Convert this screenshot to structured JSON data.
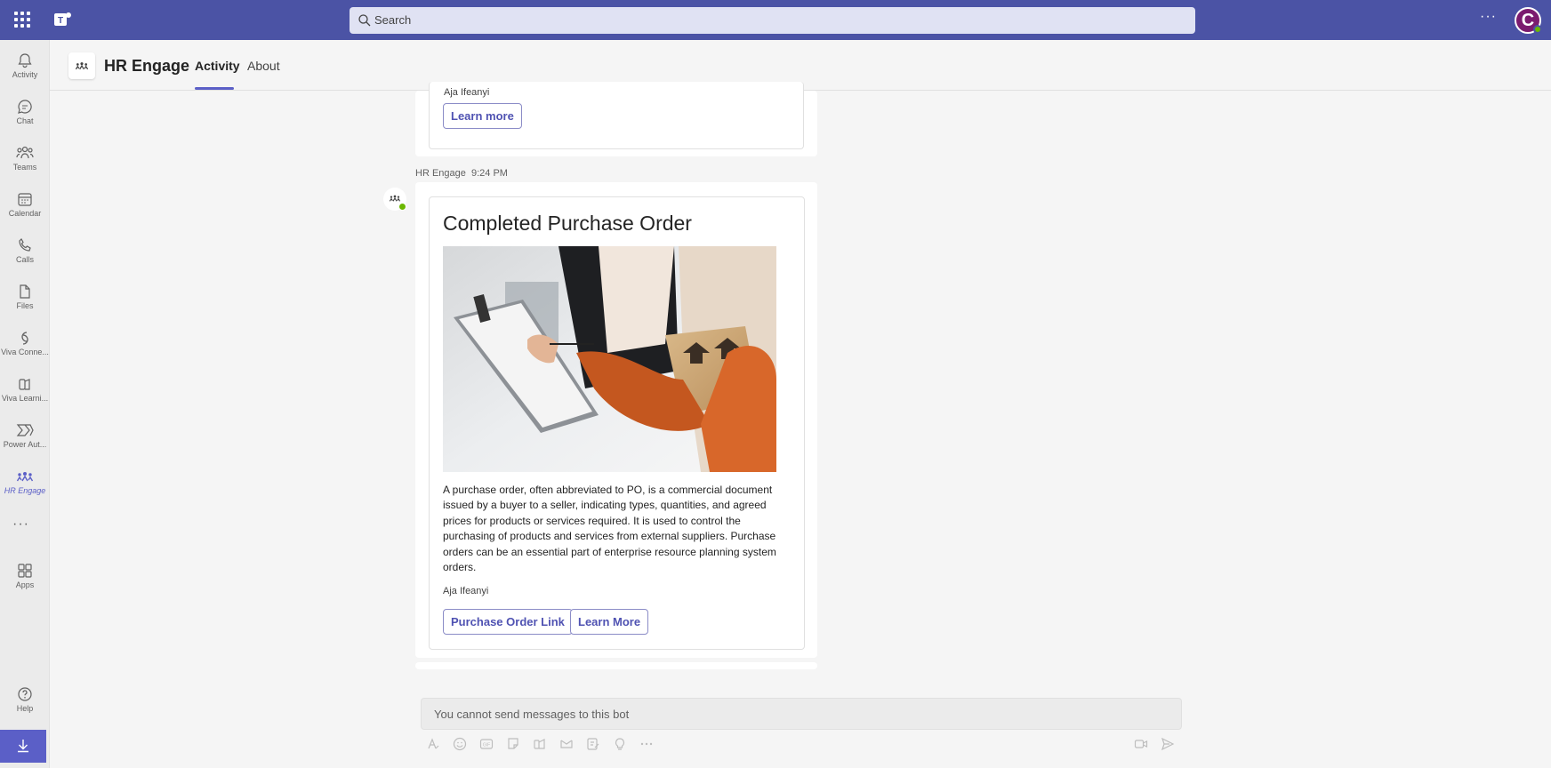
{
  "topbar": {
    "search_placeholder": "Search",
    "more_label": "···",
    "avatar_initial": "C"
  },
  "rail": {
    "items": [
      {
        "label": "Activity",
        "icon": "bell-icon"
      },
      {
        "label": "Chat",
        "icon": "chat-icon"
      },
      {
        "label": "Teams",
        "icon": "teams-icon"
      },
      {
        "label": "Calendar",
        "icon": "calendar-icon"
      },
      {
        "label": "Calls",
        "icon": "phone-icon"
      },
      {
        "label": "Files",
        "icon": "file-icon"
      },
      {
        "label": "Viva Conne...",
        "icon": "viva-connections-icon"
      },
      {
        "label": "Viva Learni...",
        "icon": "viva-learning-icon"
      },
      {
        "label": "Power Aut...",
        "icon": "power-automate-icon"
      },
      {
        "label": "HR Engage",
        "icon": "hr-engage-icon"
      }
    ],
    "more_label": "···",
    "apps_label": "Apps",
    "help_label": "Help"
  },
  "app": {
    "title": "HR Engage",
    "tabs": [
      {
        "label": "Activity",
        "active": true
      },
      {
        "label": "About",
        "active": false
      }
    ]
  },
  "prev_card": {
    "author": "Aja Ifeanyi",
    "button": "Learn more"
  },
  "message": {
    "sender": "HR Engage",
    "time": "9:24 PM",
    "title": "Completed Purchase Order",
    "body": "A purchase order, often abbreviated to PO, is a commercial document issued by a buyer to a seller, indicating types, quantities, and agreed prices for products or services required. It is used to control the purchasing of products and services from external suppliers. Purchase orders can be an essential part of enterprise resource planning system orders.",
    "author": "Aja Ifeanyi",
    "buttons": [
      "Purchase Order Link",
      "Learn More"
    ]
  },
  "composer": {
    "placeholder": "You cannot send messages to this bot"
  },
  "colors": {
    "brand": "#4b53a5",
    "accent": "#5b5fc7",
    "presence": "#6bb700"
  }
}
